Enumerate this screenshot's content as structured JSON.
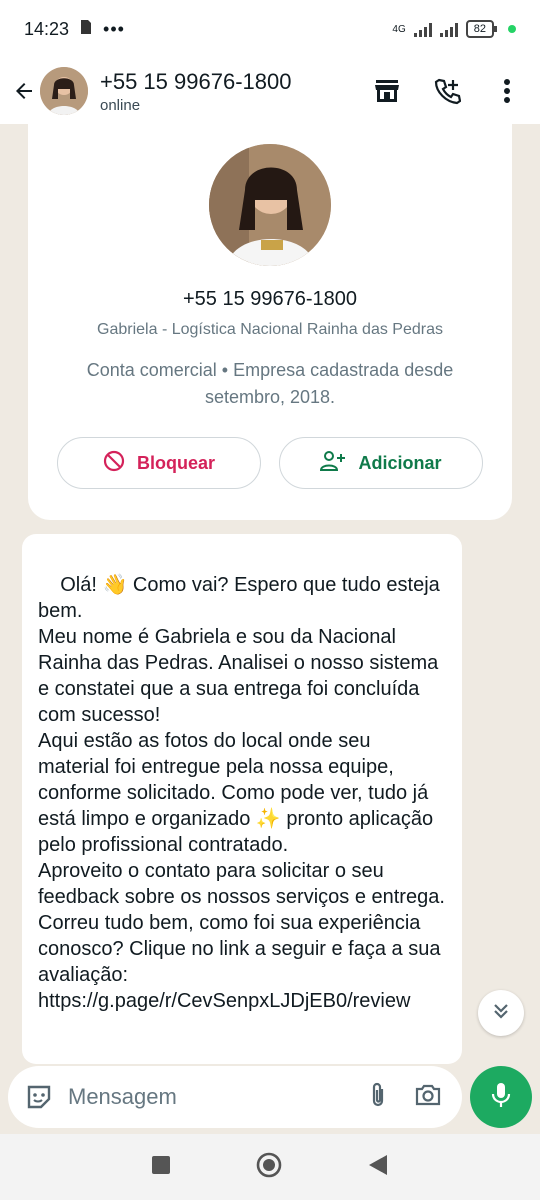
{
  "status": {
    "time": "14:23",
    "network": "4G",
    "battery": "82"
  },
  "header": {
    "title": "+55 15 99676-1800",
    "subtitle": "online"
  },
  "business_card": {
    "phone": "+55 15 99676-1800",
    "name": "Gabriela - Logística Nacional Rainha das Pedras",
    "meta": "Conta comercial • Empresa cadastrada desde setembro, 2018.",
    "block_label": "Bloquear",
    "add_label": "Adicionar"
  },
  "message": {
    "text": "Olá! 👋 Como vai? Espero que tudo esteja bem.\nMeu nome é Gabriela e sou da Nacional Rainha das Pedras. Analisei o nosso sistema e constatei que a sua entrega foi concluída com sucesso!\nAqui estão as fotos do local onde seu material foi entregue pela nossa equipe, conforme solicitado. Como pode ver, tudo já está limpo e organizado ✨ pronto aplicação pelo profissional contratado.\nAproveito o contato para solicitar o seu feedback sobre os nossos serviços e entrega. Correu tudo bem, como foi sua experiência conosco? Clique no link a seguir e faça a sua avaliação: https://g.page/r/CevSenpxLJDjEB0/review"
  },
  "composer": {
    "placeholder": "Mensagem"
  },
  "colors": {
    "accent_green": "#1daa61",
    "block_red": "#d4225a",
    "add_green": "#0f7a4a",
    "chat_bg": "#efeae2"
  },
  "icons": [
    "back-arrow-icon",
    "store-icon",
    "add-call-icon",
    "more-vert-icon",
    "block-icon",
    "add-contact-icon",
    "sticker-icon",
    "attach-icon",
    "camera-icon",
    "mic-icon",
    "chevron-double-down-icon"
  ]
}
